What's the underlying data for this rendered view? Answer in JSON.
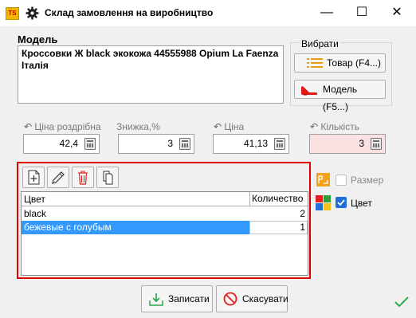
{
  "window": {
    "logo_text": "TS",
    "title": "Склад замовлення на виробництво",
    "minimize": "—",
    "maximize": "☐",
    "close": "✕"
  },
  "model": {
    "label": "Модель",
    "text": "Кроссовки Ж black экокожа 44555988 Opium La Faenza Італія"
  },
  "choose": {
    "label": "Вибрати",
    "product_button": "Товар (F4...)",
    "model_button": "Модель (F5...)"
  },
  "fields": {
    "retail_price": {
      "label": "Ціна роздрібна",
      "value": "42,4"
    },
    "discount": {
      "label": "Знижка,%",
      "value": "3"
    },
    "price": {
      "label": "Ціна",
      "value": "41,13"
    },
    "quantity": {
      "label": "Кількість",
      "value": "3"
    }
  },
  "grid": {
    "columns": [
      "Цвет",
      "Количество"
    ],
    "rows": [
      {
        "color": "black",
        "qty": "2",
        "selected": false
      },
      {
        "color": "бежевые с голубым",
        "qty": "1",
        "selected": true
      }
    ]
  },
  "options": {
    "size_label": "Размер",
    "size_checked": false,
    "color_label": "Цвет",
    "color_checked": true
  },
  "footer": {
    "save_button": "Записати",
    "cancel_button": "Скасувати"
  },
  "colors": {
    "accent_red": "#e00000",
    "selection_blue": "#3399ff",
    "check_green": "#2fa84f"
  }
}
